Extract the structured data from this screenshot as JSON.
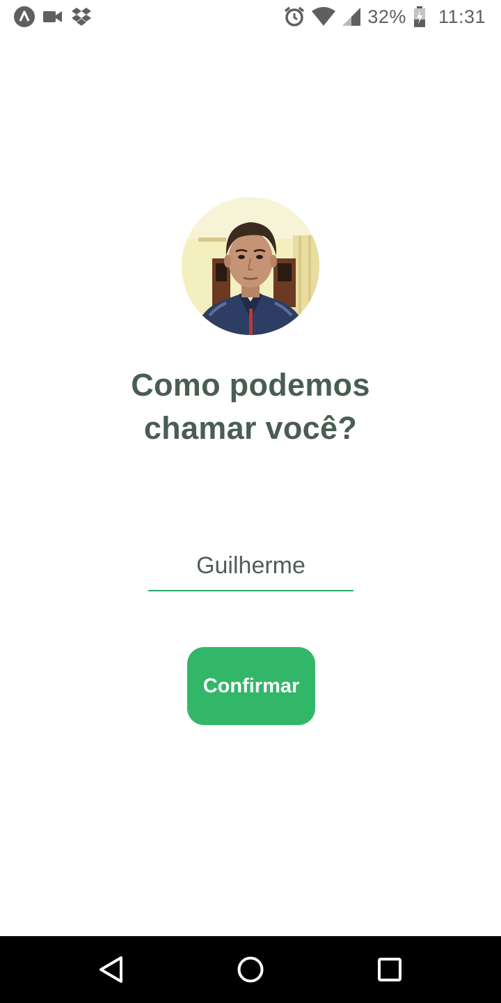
{
  "status_bar": {
    "battery_percent": "32%",
    "time": "11:31",
    "icons": [
      "app-notification-icon",
      "video-camera-icon",
      "dropbox-icon",
      "alarm-icon",
      "wifi-icon",
      "signal-icon",
      "battery-charging-icon"
    ]
  },
  "profile": {
    "avatar": "user-photo"
  },
  "heading": {
    "line1": "Como podemos",
    "line2": "chamar você?"
  },
  "name_input": {
    "value": "Guilherme"
  },
  "confirm_button": {
    "label": "Confirmar"
  },
  "nav_bar": {
    "icons": [
      "back-icon",
      "home-icon",
      "recents-icon"
    ]
  },
  "colors": {
    "heading": "#4a5d52",
    "accent_green": "#32b768",
    "input_underline": "#2fa56b",
    "status_gray": "#5f5f5f"
  }
}
